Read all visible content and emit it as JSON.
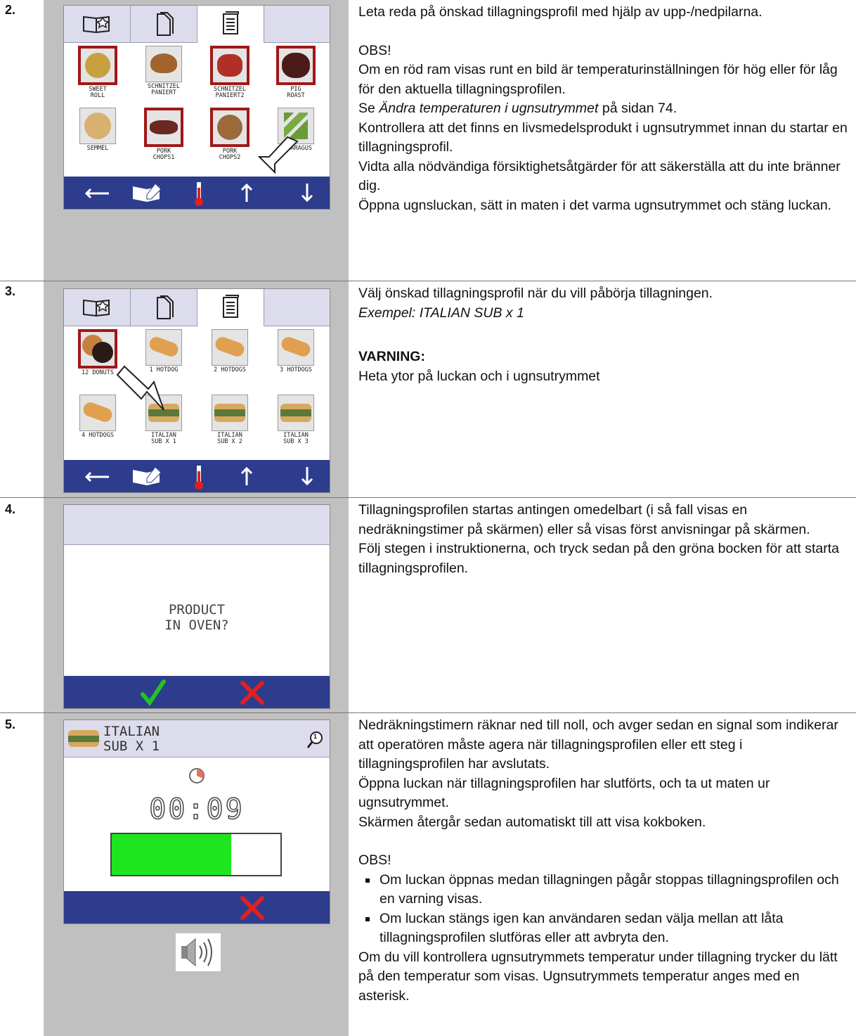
{
  "steps": [
    {
      "number": "2.",
      "text": {
        "p1": "Leta reda på önskad tillagningsprofil med hjälp av upp-/nedpilarna.",
        "obs": "OBS!",
        "p2": "Om en röd ram visas runt en bild är temperaturinställningen för hög eller för låg för den aktuella tillagningsprofilen.",
        "p3_pre": "Se ",
        "p3_italic": "Ändra temperaturen i ugnsutrymmet",
        "p3_post": " på sidan 74.",
        "p4": "Kontrollera att det finns en livsmedelsprodukt i ugnsutrymmet innan du startar en tillagningsprofil.",
        "p5": "Vidta alla nödvändiga försiktighetsåtgärder för att säkerställa att du inte bränner dig.",
        "p6": "Öppna ugnsluckan, sätt in maten i det varma ugnsutrymmet och stäng luckan."
      },
      "screen": {
        "tiles": [
          {
            "label": "SWEET\nROLL",
            "warn": true,
            "color": "#c8a040"
          },
          {
            "label": "SCHNITZEL\nPANIERT",
            "warn": false,
            "color": "#a0642c"
          },
          {
            "label": "SCHNITZEL\nPANIERT2",
            "warn": true,
            "color": "#b03028"
          },
          {
            "label": "PIG\nROAST",
            "warn": true,
            "color": "#4a1a18"
          },
          {
            "label": "SEMMEL",
            "warn": false,
            "color": "#d8b070"
          },
          {
            "label": "PORK\nCHOPS1",
            "warn": true,
            "color": "#6a2820"
          },
          {
            "label": "PORK\nCHOPS2",
            "warn": true,
            "color": "#9a6a3a"
          },
          {
            "label": "ASPARAGUS",
            "warn": false,
            "color": "#6a9a3a"
          }
        ]
      }
    },
    {
      "number": "3.",
      "text": {
        "p1": "Välj önskad tillagningsprofil när du vill påbörja tillagningen.",
        "p2_italic": "Exempel: ITALIAN SUB x 1",
        "warning_title": "VARNING:",
        "warning_text": "Heta ytor på luckan och i ugnsutrymmet"
      },
      "screen": {
        "tiles": [
          {
            "label": "12 DONUTS",
            "warn": true,
            "color": "#7a3a2a"
          },
          {
            "label": "1 HOTDOG",
            "warn": false,
            "color": "#e0a050"
          },
          {
            "label": "2 HOTDOGS",
            "warn": false,
            "color": "#e0a050"
          },
          {
            "label": "3 HOTDOGS",
            "warn": false,
            "color": "#e0a050"
          },
          {
            "label": "4 HOTDOGS",
            "warn": false,
            "color": "#e0a050"
          },
          {
            "label": "ITALIAN\nSUB X 1",
            "warn": false,
            "color": "#5a7a3a"
          },
          {
            "label": "ITALIAN\nSUB X 2",
            "warn": false,
            "color": "#5a7a3a"
          },
          {
            "label": "ITALIAN\nSUB X 3",
            "warn": false,
            "color": "#5a7a3a"
          }
        ]
      }
    },
    {
      "number": "4.",
      "text": {
        "p1": "Tillagningsprofilen startas antingen omedelbart (i så fall visas en nedräkningstimer på skärmen) eller så visas först anvisningar på skärmen.",
        "p2": "Följ stegen i instruktionerna, och tryck sedan på den gröna bocken för att starta tillagningsprofilen."
      },
      "screen": {
        "prompt_line1": "PRODUCT",
        "prompt_line2": "IN OVEN?"
      }
    },
    {
      "number": "5.",
      "text": {
        "p1": "Nedräkningstimern räknar ned till noll, och avger sedan en signal som indikerar att operatören måste agera när tillagningsprofilen eller ett steg i tillagningsprofilen har avslutats.",
        "p2": "Öppna luckan när tillagningsprofilen har slutförts, och ta ut maten ur ugnsutrymmet.",
        "p3": "Skärmen återgår sedan automatiskt till att visa kokboken.",
        "obs": "OBS!",
        "bullet1": "Om luckan öppnas medan tillagningen pågår stoppas tillagningsprofilen och en varning visas.",
        "bullet2": "Om luckan stängs igen kan användaren sedan välja mellan att låta tillagningsprofilen slutföras eller att avbryta den.",
        "p4": "Om du vill kontrollera ugnsutrymmets temperatur under tillagning trycker du lätt på den temperatur som visas. Ugnsutrymmets temperatur anges med en asterisk."
      },
      "screen": {
        "title_line1": "ITALIAN",
        "title_line2": "SUB X 1",
        "magnifier_badge": "1",
        "timer": "00:09",
        "progress_fraction": 0.71
      }
    }
  ],
  "colors": {
    "bar_blue": "#2d3c8c",
    "warn_red": "#a01818",
    "check_green": "#22c422",
    "cancel_red": "#e02020",
    "progress_green": "#1ee61e"
  }
}
